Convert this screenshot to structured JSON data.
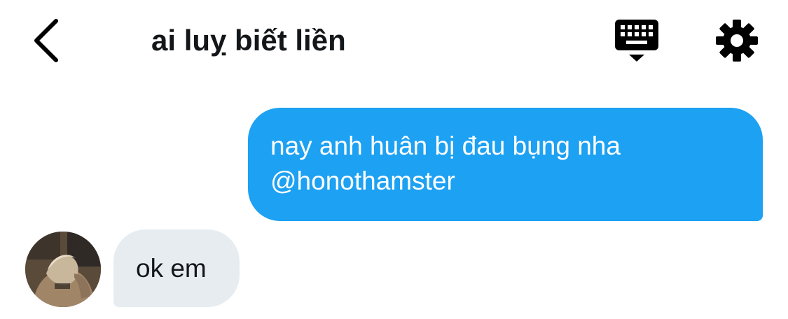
{
  "header": {
    "title": "ai luỵ biết liền",
    "back_icon": "chevron-left-icon",
    "keyboard_icon": "keyboard-hide-icon",
    "settings_icon": "gear-icon"
  },
  "messages": [
    {
      "direction": "outgoing",
      "lines": [
        "nay anh huân bị đau bụng nha",
        "@honothamster"
      ]
    },
    {
      "direction": "incoming",
      "text": "ok em"
    }
  ],
  "colors": {
    "outgoing_bubble": "#1da1f2",
    "incoming_bubble": "#e6ecf0",
    "text": "#14171a",
    "icons": "#000000"
  }
}
